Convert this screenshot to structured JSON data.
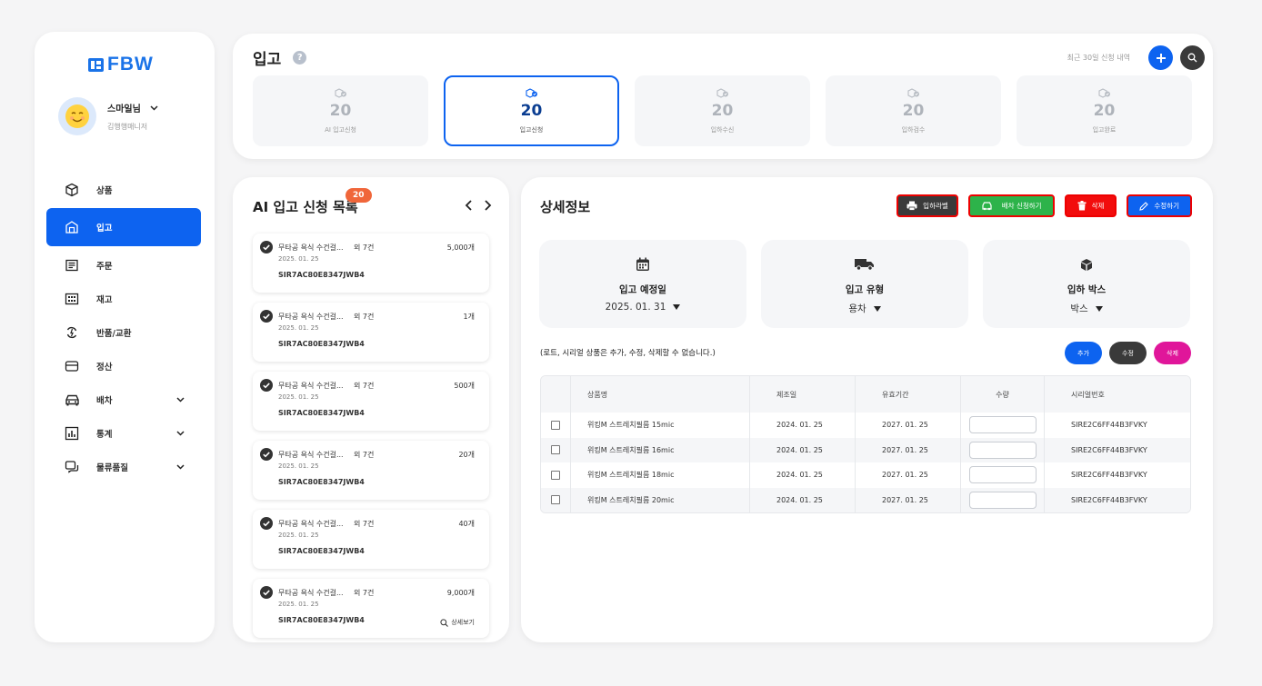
{
  "logo": {
    "text": "FBW"
  },
  "profile": {
    "name": "스마일님",
    "role": "김행행매니저"
  },
  "nav": {
    "items": [
      {
        "label": "상품",
        "icon": "box-icon",
        "chevron": false,
        "active": false
      },
      {
        "label": "입고",
        "icon": "warehouse-icon",
        "chevron": false,
        "active": true
      },
      {
        "label": "주문",
        "icon": "order-icon",
        "chevron": false,
        "active": false
      },
      {
        "label": "재고",
        "icon": "inventory-grid-icon",
        "chevron": false,
        "active": false
      },
      {
        "label": "반품/교환",
        "icon": "exchange-icon",
        "chevron": false,
        "active": false
      },
      {
        "label": "정산",
        "icon": "card-icon",
        "chevron": false,
        "active": false
      },
      {
        "label": "배차",
        "icon": "car-icon",
        "chevron": true,
        "active": false
      },
      {
        "label": "통계",
        "icon": "chart-icon",
        "chevron": true,
        "active": false
      },
      {
        "label": "물류품질",
        "icon": "chat-icon",
        "chevron": true,
        "active": false
      }
    ]
  },
  "header": {
    "title": "입고",
    "help": "?",
    "recent_label": "최근 30일 신청 내역",
    "stats": [
      {
        "count": "20",
        "label": "AI 입고신청",
        "active": false
      },
      {
        "count": "20",
        "label": "입고신청",
        "active": true
      },
      {
        "count": "20",
        "label": "입하수신",
        "active": false
      },
      {
        "count": "20",
        "label": "입하검수",
        "active": false
      },
      {
        "count": "20",
        "label": "입고완료",
        "active": false
      }
    ]
  },
  "list": {
    "title": "AI 입고 신청 목록",
    "badge": "20",
    "detail_link": "상세보기",
    "items": [
      {
        "name": "무타공 욕식 수건걸...",
        "more": "외 7건",
        "qty": "5,000개",
        "date": "2025. 01. 25",
        "code": "SIR7AC80E8347JWB4"
      },
      {
        "name": "무타공 욕식 수건걸...",
        "more": "외 7건",
        "qty": "1개",
        "date": "2025. 01. 25",
        "code": "SIR7AC80E8347JWB4"
      },
      {
        "name": "무타공 욕식 수건걸...",
        "more": "외 7건",
        "qty": "500개",
        "date": "2025. 01. 25",
        "code": "SIR7AC80E8347JWB4"
      },
      {
        "name": "무타공 욕식 수건걸...",
        "more": "외 7건",
        "qty": "20개",
        "date": "2025. 01. 25",
        "code": "SIR7AC80E8347JWB4"
      },
      {
        "name": "무타공 욕식 수건걸...",
        "more": "외 7건",
        "qty": "40개",
        "date": "2025. 01. 25",
        "code": "SIR7AC80E8347JWB4"
      },
      {
        "name": "무타공 욕식 수건걸...",
        "more": "외 7건",
        "qty": "9,000개",
        "date": "2025. 01. 25",
        "code": "SIR7AC80E8347JWB4"
      }
    ]
  },
  "detail": {
    "title": "상세정보",
    "actions": {
      "print": "입하라벨",
      "dispatch": "배차 신청하기",
      "delete": "삭제",
      "edit": "수정하기"
    },
    "info": [
      {
        "label": "입고 예정일",
        "value": "2025. 01. 31"
      },
      {
        "label": "입고 유형",
        "value": "용차"
      },
      {
        "label": "입하 박스",
        "value": "박스"
      }
    ],
    "notice": "(로트, 시리얼 상품은 추가, 수정, 삭제할 수 없습니다.)",
    "pills": {
      "add": "추가",
      "edit": "수정",
      "delete": "삭제"
    },
    "table": {
      "headers": [
        "상품명",
        "제조일",
        "유효기간",
        "수량",
        "시리얼번호"
      ],
      "rows": [
        {
          "name": "위킹M 스트레치필름 15mic",
          "mfg": "2024. 01. 25",
          "exp": "2027. 01. 25",
          "serial": "SIRE2C6FF44B3FVKY"
        },
        {
          "name": "위킹M 스트레치필름 16mic",
          "mfg": "2024. 01. 25",
          "exp": "2027. 01. 25",
          "serial": "SIRE2C6FF44B3FVKY"
        },
        {
          "name": "위킹M 스트레치필름 18mic",
          "mfg": "2024. 01. 25",
          "exp": "2027. 01. 25",
          "serial": "SIRE2C6FF44B3FVKY"
        },
        {
          "name": "위킹M 스트레치필름 20mic",
          "mfg": "2024. 01. 25",
          "exp": "2027. 01. 25",
          "serial": "SIRE2C6FF44B3FVKY"
        }
      ]
    }
  },
  "colors": {
    "primary": "#0d63f0",
    "green": "#2db34a",
    "red": "#f20c0c",
    "dark": "#3a3a3a",
    "magenta": "#e0169a",
    "badge": "#f0663a"
  }
}
